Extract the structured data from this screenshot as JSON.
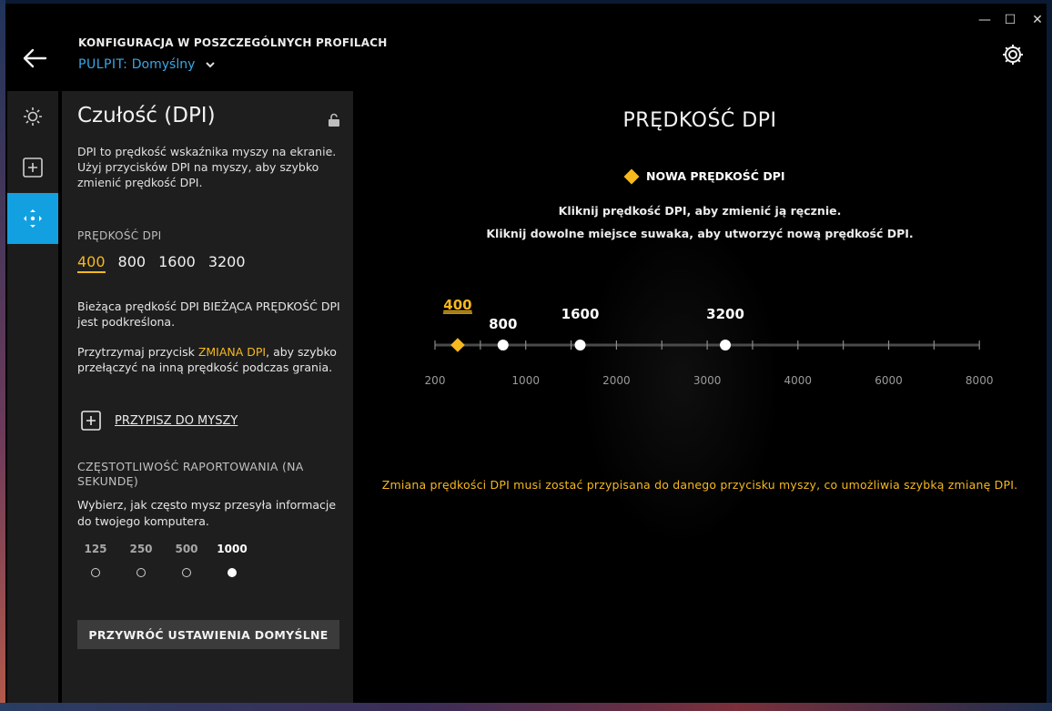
{
  "window": {
    "minimize_label": "—",
    "maximize_label": "☐",
    "close_label": "✕"
  },
  "header": {
    "title": "KONFIGURACJA W POSZCZEGÓLNYCH PROFILACH",
    "profile_label": "PULPIT:",
    "profile_value": "Domyślny"
  },
  "icons": {
    "back": "arrow-left-icon",
    "settings": "gear-icon",
    "tabs": [
      "sun-icon",
      "plus-square-icon",
      "move-arrows-icon"
    ],
    "lock": "unlock-icon",
    "assign": "plus-square-icon"
  },
  "colors": {
    "accent": "#f5b81f",
    "active_tab": "#12a0e0",
    "profile": "#39a7e6"
  },
  "panel": {
    "title": "Czułość (DPI)",
    "description": "DPI to prędkość wskaźnika myszy na ekranie. Użyj przycisków DPI na myszy, aby szybko zmienić prędkość DPI.",
    "dpi_section_label": "PRĘDKOŚĆ DPI",
    "dpi_values": [
      "400",
      "800",
      "1600",
      "3200"
    ],
    "dpi_selected": "400",
    "current_desc": "Bieżąca prędkość DPI BIEŻĄCA PRĘDKOŚĆ DPI jest podkreślona.",
    "hold_prefix": "Przytrzymaj przycisk ",
    "hold_accent": "ZMIANA DPI",
    "hold_suffix": ", aby szybko przełączyć na inną prędkość podczas grania.",
    "assign_label": "PRZYPISZ DO MYSZY",
    "rate_label": "CZĘSTOTLIWOŚĆ RAPORTOWANIA (NA SEKUNDĘ)",
    "rate_desc": "Wybierz, jak często mysz przesyła informacje do twojego komputera.",
    "rate_options": [
      "125",
      "250",
      "500",
      "1000"
    ],
    "rate_selected": "1000",
    "reset_label": "PRZYWRÓĆ USTAWIENIA DOMYŚLNE"
  },
  "right": {
    "title": "PRĘDKOŚĆ DPI",
    "legend_label": "NOWA PRĘDKOŚĆ DPI",
    "instruction_1": "Kliknij prędkość DPI, aby zmienić ją ręcznie.",
    "instruction_2": "Kliknij dowolne miejsce suwaka, aby utworzyć nową prędkość DPI.",
    "warning": "Zmiana prędkości DPI musi zostać przypisana do danego przycisku myszy, co umożliwia szybką zmianę DPI.",
    "slider": {
      "axis_labels": [
        "200",
        "1000",
        "2000",
        "3000",
        "4000",
        "6000",
        "8000"
      ],
      "points": [
        {
          "label": "400",
          "value": 400,
          "selected": true
        },
        {
          "label": "800",
          "value": 800,
          "selected": false
        },
        {
          "label": "1600",
          "value": 1600,
          "selected": false
        },
        {
          "label": "3200",
          "value": 3200,
          "selected": false
        }
      ]
    }
  }
}
